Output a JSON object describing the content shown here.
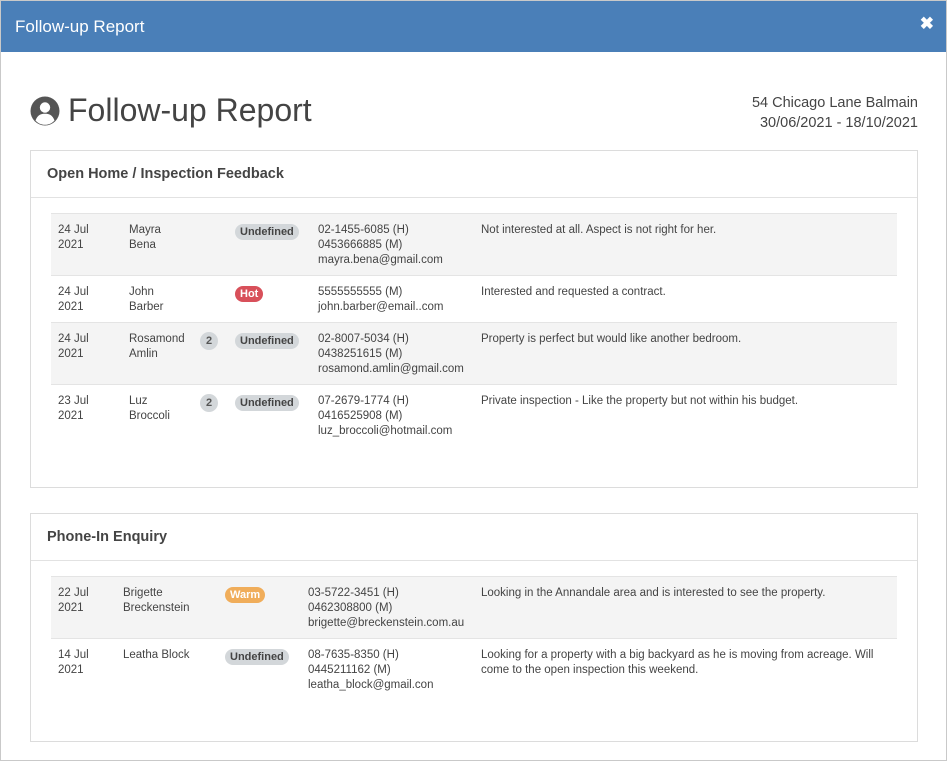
{
  "modal": {
    "title": "Follow-up Report",
    "close_label": "✖"
  },
  "report": {
    "title": "Follow-up Report",
    "address": "54 Chicago Lane Balmain",
    "date_range": "30/06/2021 - 18/10/2021"
  },
  "sections": [
    {
      "title": "Open Home / Inspection Feedback",
      "rows": [
        {
          "date1": "24 Jul",
          "date2": "2021",
          "name1": "Mayra",
          "name2": "Bena",
          "count": "",
          "status": "Undefined",
          "status_type": "undefined",
          "contact": [
            "02-1455-6085 (H)",
            "0453666885 (M)",
            "mayra.bena@gmail.com"
          ],
          "feedback": "Not interested at all. Aspect is not right for her."
        },
        {
          "date1": "24 Jul",
          "date2": "2021",
          "name1": "John",
          "name2": "Barber",
          "count": "",
          "status": "Hot",
          "status_type": "hot",
          "contact": [
            "5555555555 (M)",
            "john.barber@email..com",
            ""
          ],
          "feedback": "Interested and requested a contract."
        },
        {
          "date1": "24 Jul",
          "date2": "2021",
          "name1": "Rosamond",
          "name2": "Amlin",
          "count": "2",
          "status": "Undefined",
          "status_type": "undefined",
          "contact": [
            "02-8007-5034 (H)",
            "0438251615 (M)",
            "rosamond.amlin@gmail.com"
          ],
          "feedback": "Property is perfect but would like another bedroom."
        },
        {
          "date1": "23 Jul",
          "date2": "2021",
          "name1": "Luz",
          "name2": "Broccoli",
          "count": "2",
          "status": "Undefined",
          "status_type": "undefined",
          "contact": [
            "07-2679-1774 (H)",
            "0416525908 (M)",
            "luz_broccoli@hotmail.com"
          ],
          "feedback": "Private inspection - Like the property but not within his budget."
        }
      ]
    },
    {
      "title": "Phone-In Enquiry",
      "rows": [
        {
          "date1": "22 Jul",
          "date2": "2021",
          "name1": "Brigette",
          "name2": "Breckenstein",
          "count": "",
          "status": "Warm",
          "status_type": "warm",
          "contact": [
            "03-5722-3451 (H)",
            "0462308800 (M)",
            "brigette@breckenstein.com.au"
          ],
          "feedback": "Looking in the Annandale area and is interested to see the property."
        },
        {
          "date1": "14 Jul",
          "date2": "2021",
          "name1": "Leatha Block",
          "name2": "",
          "count": "",
          "status": "Undefined",
          "status_type": "undefined",
          "contact": [
            "08-7635-8350 (H)",
            "0445211162 (M)",
            "leatha_block@gmail.con"
          ],
          "feedback": "Looking for a property with a big backyard as he is moving from acreage. Will come to the open inspection this weekend."
        }
      ]
    }
  ]
}
